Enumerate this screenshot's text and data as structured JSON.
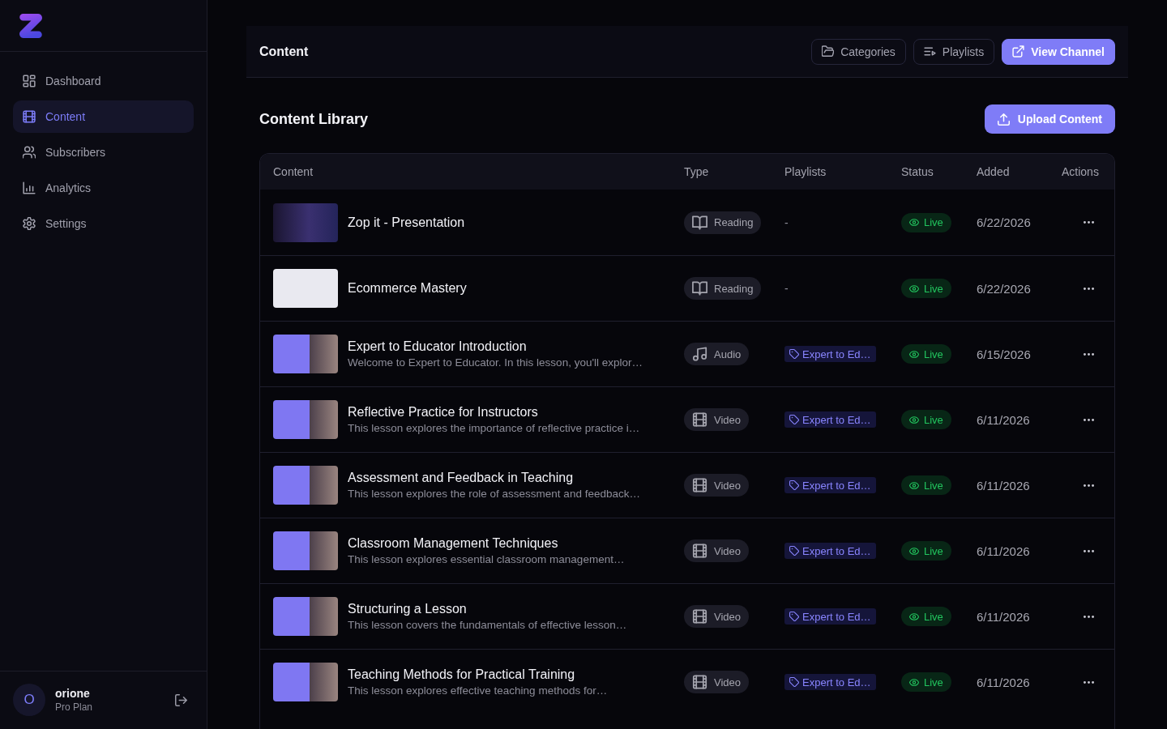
{
  "sidebar": {
    "nav": [
      {
        "label": "Dashboard",
        "kind": "dashboard",
        "selected": false
      },
      {
        "label": "Content",
        "kind": "content",
        "selected": true
      },
      {
        "label": "Subscribers",
        "kind": "subscribers",
        "selected": false
      },
      {
        "label": "Analytics",
        "kind": "analytics",
        "selected": false
      },
      {
        "label": "Settings",
        "kind": "settings",
        "selected": false
      }
    ],
    "user": {
      "initial": "O",
      "name": "orione",
      "plan": "Pro Plan"
    }
  },
  "header": {
    "title": "Content",
    "buttons": [
      {
        "label": "Categories",
        "kind": "categories",
        "primary": false
      },
      {
        "label": "Playlists",
        "kind": "playlists",
        "primary": false
      },
      {
        "label": "View Channel",
        "kind": "channel",
        "primary": true
      }
    ]
  },
  "library": {
    "title": "Content Library",
    "upload_button": "Upload Content"
  },
  "table": {
    "columns": [
      "Content",
      "Type",
      "Playlists",
      "Status",
      "Added",
      "Actions"
    ],
    "rows": [
      {
        "title": "Zop it - Presentation",
        "type": {
          "label": "Reading",
          "kind": "reading"
        },
        "playlist": {
          "label": "-",
          "kind": "none"
        },
        "status": {
          "label": "Live",
          "kind": "live"
        },
        "added": "6/22/2026"
      },
      {
        "title": "Ecommerce Mastery",
        "type": {
          "label": "Reading",
          "kind": "reading"
        },
        "playlist": {
          "label": "-",
          "kind": "none"
        },
        "status": {
          "label": "Live",
          "kind": "live"
        },
        "added": "6/22/2026"
      },
      {
        "title": "Expert to Educator Introduction",
        "description": "Welcome to Expert to Educator. In this lesson, you'll explor…",
        "type": {
          "label": "Audio",
          "kind": "audio"
        },
        "playlist": {
          "label": "Expert to Ed…",
          "kind": "tag"
        },
        "status": {
          "label": "Live",
          "kind": "live"
        },
        "added": "6/15/2026"
      },
      {
        "title": "Reflective Practice for Instructors",
        "description": "This lesson explores the importance of reflective practice i…",
        "type": {
          "label": "Video",
          "kind": "video"
        },
        "playlist": {
          "label": "Expert to Ed…",
          "kind": "tag"
        },
        "status": {
          "label": "Live",
          "kind": "live"
        },
        "added": "6/11/2026"
      },
      {
        "title": "Assessment and Feedback in Teaching",
        "description": "This lesson explores the role of assessment and feedback…",
        "type": {
          "label": "Video",
          "kind": "video"
        },
        "playlist": {
          "label": "Expert to Ed…",
          "kind": "tag"
        },
        "status": {
          "label": "Live",
          "kind": "live"
        },
        "added": "6/11/2026"
      },
      {
        "title": "Classroom Management Techniques",
        "description": "This lesson explores essential classroom management…",
        "type": {
          "label": "Video",
          "kind": "video"
        },
        "playlist": {
          "label": "Expert to Ed…",
          "kind": "tag"
        },
        "status": {
          "label": "Live",
          "kind": "live"
        },
        "added": "6/11/2026"
      },
      {
        "title": "Structuring a Lesson",
        "description": "This lesson covers the fundamentals of effective lesson…",
        "type": {
          "label": "Video",
          "kind": "video"
        },
        "playlist": {
          "label": "Expert to Ed…",
          "kind": "tag"
        },
        "status": {
          "label": "Live",
          "kind": "live"
        },
        "added": "6/11/2026"
      },
      {
        "title": "Teaching Methods for Practical Training",
        "description": "This lesson explores effective teaching methods for…",
        "type": {
          "label": "Video",
          "kind": "video"
        },
        "playlist": {
          "label": "Expert to Ed…",
          "kind": "tag"
        },
        "status": {
          "label": "Live",
          "kind": "live"
        },
        "added": "6/11/2026"
      }
    ]
  }
}
